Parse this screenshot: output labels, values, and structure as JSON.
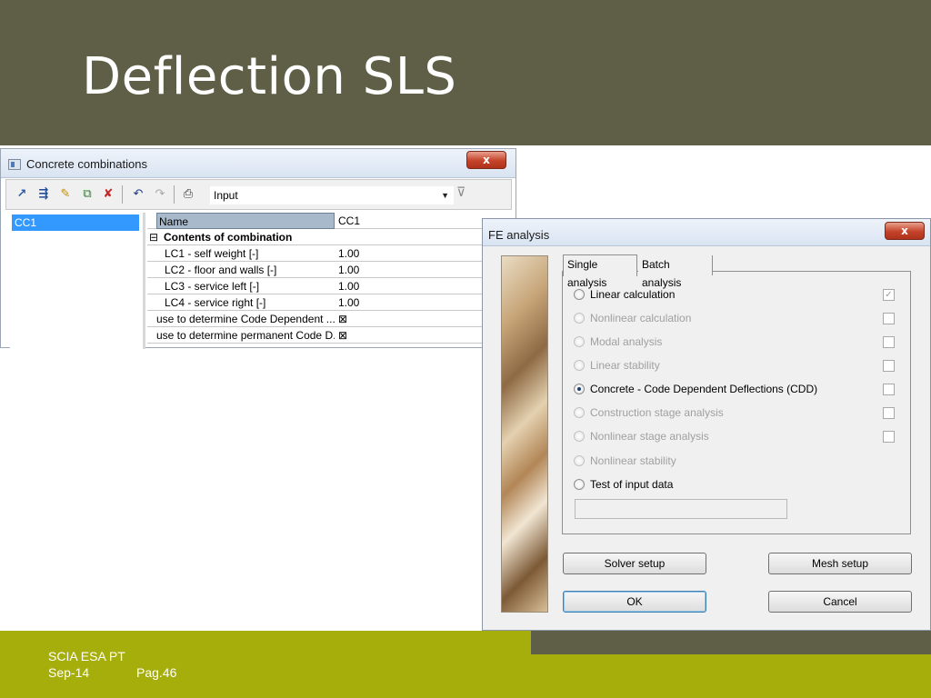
{
  "slide": {
    "title": "Deflection SLS",
    "footer": {
      "company": "SCIA ESA PT",
      "date": "Sep-14",
      "page": "Pag.46"
    },
    "colors": {
      "title_band": "#5e5f46",
      "footer_band": "#a5ae0a"
    }
  },
  "concrete_combinations": {
    "window_title": "Concrete combinations",
    "close_label": "x",
    "toolbar": {
      "combo_value": "Input",
      "icons": [
        "new-icon",
        "properties-icon",
        "edit-icon",
        "copy-icon",
        "delete-icon",
        "undo-icon",
        "redo-icon",
        "print-icon",
        "filter-icon"
      ]
    },
    "list": {
      "selected_item": "CC1"
    },
    "grid": {
      "name_label": "Name",
      "name_value": "CC1",
      "contents_header": "Contents of combination",
      "expander": "⊟",
      "rows": [
        {
          "label": "LC1 - self weight [-]",
          "value": "1.00"
        },
        {
          "label": "LC2 - floor and walls [-]",
          "value": "1.00"
        },
        {
          "label": "LC3 - service left [-]",
          "value": "1.00"
        },
        {
          "label": "LC4 - service right [-]",
          "value": "1.00"
        }
      ],
      "flags": [
        {
          "label": "use to determine Code Dependent ...",
          "value": "⊠"
        },
        {
          "label": "use to determine permanent Code D...",
          "value": "⊠"
        }
      ]
    }
  },
  "fe_analysis": {
    "window_title": "FE analysis",
    "close_label": "x",
    "tabs": [
      "Single analysis",
      "Batch analysis"
    ],
    "active_tab": "Single analysis",
    "options": [
      {
        "label": "Linear calculation",
        "enabled": true,
        "selected": false,
        "checkbox": "checked-disabled"
      },
      {
        "label": "Nonlinear calculation",
        "enabled": false,
        "selected": false,
        "checkbox": "unchecked"
      },
      {
        "label": "Modal analysis",
        "enabled": false,
        "selected": false,
        "checkbox": "unchecked"
      },
      {
        "label": "Linear stability",
        "enabled": false,
        "selected": false,
        "checkbox": "unchecked"
      },
      {
        "label": "Concrete - Code Dependent Deflections (CDD)",
        "enabled": true,
        "selected": true,
        "checkbox": "unchecked"
      },
      {
        "label": "Construction stage analysis",
        "enabled": false,
        "selected": false,
        "checkbox": "unchecked"
      },
      {
        "label": "Nonlinear stage analysis",
        "enabled": false,
        "selected": false,
        "checkbox": "unchecked"
      },
      {
        "label": "Nonlinear stability",
        "enabled": false,
        "selected": false,
        "checkbox": "none"
      },
      {
        "label": "Test of input data",
        "enabled": true,
        "selected": false,
        "checkbox": "none"
      }
    ],
    "buttons": {
      "solver_setup": "Solver setup",
      "mesh_setup": "Mesh setup",
      "ok": "OK",
      "cancel": "Cancel"
    }
  }
}
